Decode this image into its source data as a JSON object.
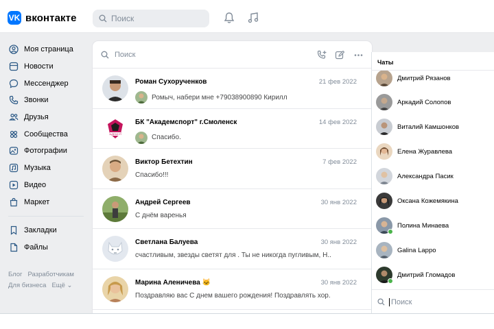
{
  "brand": {
    "logo_mark": "vk-logo",
    "name": "вконтакте",
    "accent": "#0077ff"
  },
  "header": {
    "search_placeholder": "Поиск",
    "icons": [
      "search-icon",
      "bell-icon",
      "music-note-icon"
    ]
  },
  "nav": {
    "items": [
      {
        "label": "Моя страница",
        "icon": "user-circle-icon"
      },
      {
        "label": "Новости",
        "icon": "news-icon"
      },
      {
        "label": "Мессенджер",
        "icon": "message-bubble-icon"
      },
      {
        "label": "Звонки",
        "icon": "phone-icon"
      },
      {
        "label": "Друзья",
        "icon": "friends-icon"
      },
      {
        "label": "Сообщества",
        "icon": "communities-icon"
      },
      {
        "label": "Фотографии",
        "icon": "photo-icon"
      },
      {
        "label": "Музыка",
        "icon": "music-icon"
      },
      {
        "label": "Видео",
        "icon": "video-icon"
      },
      {
        "label": "Маркет",
        "icon": "market-bag-icon"
      }
    ],
    "secondary": [
      {
        "label": "Закладки",
        "icon": "bookmark-icon"
      },
      {
        "label": "Файлы",
        "icon": "file-icon"
      }
    ],
    "footer": [
      "Блог",
      "Разработчикам",
      "Для бизнеса",
      "Ещё ⌄"
    ]
  },
  "messenger": {
    "search_placeholder": "Поиск",
    "toolbar_icons": [
      "call-add-icon",
      "compose-icon",
      "more-icon"
    ],
    "conversations": [
      {
        "name": "Роман Сухорученков",
        "date": "21 фев 2022",
        "message": "Ромыч, набери мне +79038900890 Кирилл",
        "avatar_color": "#3a3a3a",
        "mini_color": "#6f8f62"
      },
      {
        "name": "БК \"Академспорт\" г.Смоленск",
        "date": "14 фев 2022",
        "message": "Спасибо.",
        "avatar_color": "#c4145c",
        "mini_color": "#6f8f62"
      },
      {
        "name": "Виктор Бетехтин",
        "date": "7 фев 2022",
        "message": "Спасибо!!!",
        "avatar_color": "#b8946a",
        "mini_color": ""
      },
      {
        "name": "Андрей Сергеев",
        "date": "30 янв 2022",
        "message": "С днём варенья",
        "avatar_color": "#5a7a3a",
        "mini_color": ""
      },
      {
        "name": "Светлана Балуева",
        "date": "30 янв 2022",
        "message": "счастливым, звезды светят для . Ты не никогда пугливым, Н...",
        "avatar_color": "#c9d3e0",
        "mini_color": ""
      },
      {
        "name": "Марина Аленичева 🐱",
        "date": "30 янв 2022",
        "message": "Поздравляю вас С днем вашего рождения! Поздравлять хор...",
        "avatar_color": "#c7a26a",
        "mini_color": ""
      }
    ]
  },
  "chats_panel": {
    "title": "Чаты",
    "search_placeholder": "Поиск",
    "contacts": [
      {
        "name": "Дмитрий Рязанов",
        "online": false,
        "color": "#8a7a6a"
      },
      {
        "name": "Аркадий Солопов",
        "online": false,
        "color": "#6a6a6a"
      },
      {
        "name": "Виталий Камшонков",
        "online": false,
        "color": "#4a4a4a"
      },
      {
        "name": "Елена Журавлева",
        "online": false,
        "color": "#a07a5a"
      },
      {
        "name": "Александра Пасик",
        "online": false,
        "color": "#9aa0a8"
      },
      {
        "name": "Оксана Кожемякина",
        "online": false,
        "color": "#2a2a2a"
      },
      {
        "name": "Полина Минаева",
        "online": true,
        "color": "#5a6a7a"
      },
      {
        "name": "Galina Lappo",
        "online": false,
        "color": "#7a8a9a"
      },
      {
        "name": "Дмитрий Гломадов",
        "online": true,
        "color": "#2a3a2a"
      }
    ]
  },
  "colors": {
    "accent": "#0077ff",
    "bg": "#edeef0",
    "muted": "#818c99",
    "online": "#4bb34b"
  }
}
